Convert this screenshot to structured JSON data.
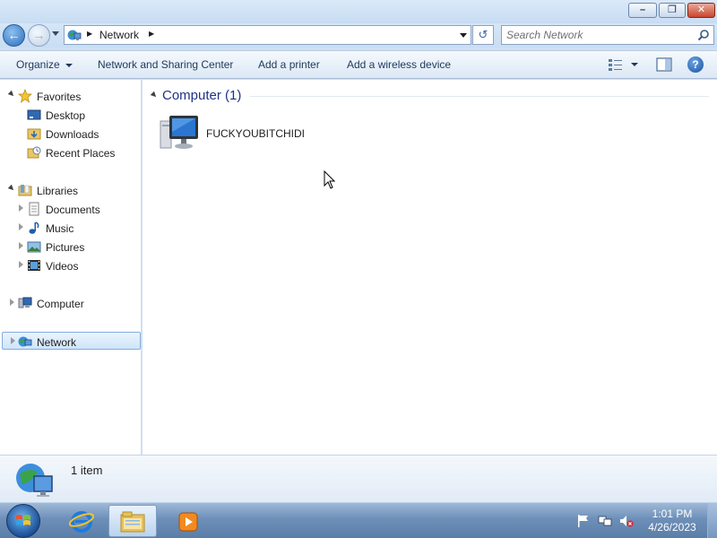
{
  "window": {
    "minimize_icon": "minimize-icon",
    "maximize_icon": "restore-icon",
    "close_icon": "close-icon"
  },
  "address": {
    "location": "Network",
    "search_placeholder": "Search Network"
  },
  "toolbar": {
    "organize": "Organize",
    "network_sharing": "Network and Sharing Center",
    "add_printer": "Add a printer",
    "add_wireless": "Add a wireless device"
  },
  "nav": {
    "favorites": "Favorites",
    "desktop": "Desktop",
    "downloads": "Downloads",
    "recent_places": "Recent Places",
    "libraries": "Libraries",
    "documents": "Documents",
    "music": "Music",
    "pictures": "Pictures",
    "videos": "Videos",
    "computer": "Computer",
    "network": "Network"
  },
  "content": {
    "group_title": "Computer (1)",
    "items": [
      {
        "name": "FUCKYOUBITCHIDI",
        "icon": "computer-icon"
      }
    ]
  },
  "details": {
    "count": "1 item"
  },
  "taskbar": {
    "time": "1:01 PM",
    "date": "4/26/2023"
  },
  "colors": {
    "accent": "#1e3287",
    "selection": "#cfe5fa",
    "taskbar": "#6d8fb8"
  }
}
